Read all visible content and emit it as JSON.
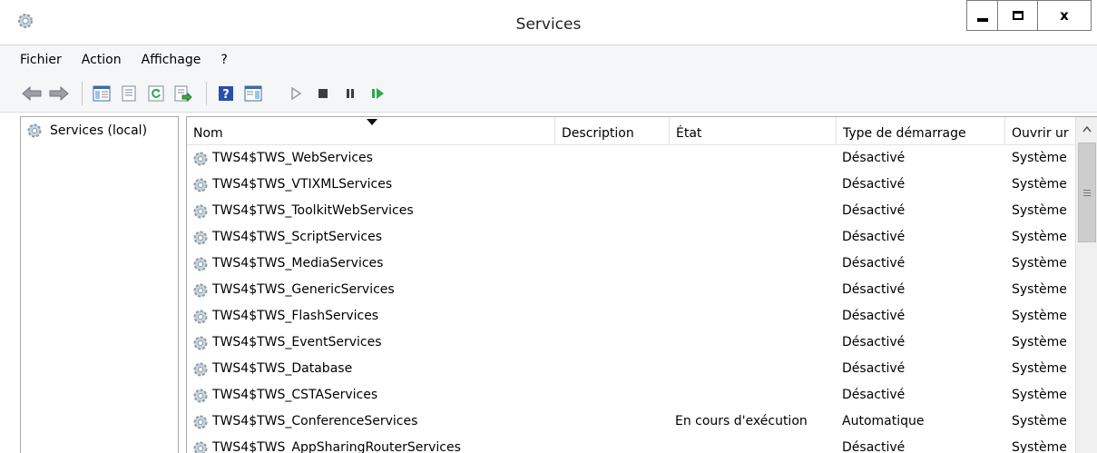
{
  "window": {
    "title": "Services",
    "minimize_label": "",
    "maximize_label": "",
    "close_label": "x"
  },
  "menubar": {
    "items": [
      "Fichier",
      "Action",
      "Affichage",
      "?"
    ]
  },
  "toolbar": {
    "buttons": [
      "back-arrow-icon",
      "forward-arrow-icon",
      "console-tree-icon",
      "properties-icon",
      "refresh-icon",
      "export-list-icon",
      "help-icon",
      "action-pane-icon",
      "start-service-icon",
      "stop-service-icon",
      "pause-service-icon",
      "restart-service-icon"
    ]
  },
  "tree": {
    "root_label": "Services (local)"
  },
  "table": {
    "columns": [
      "Nom",
      "Description",
      "État",
      "Type de démarrage",
      "Ouvrir ur"
    ],
    "sorted_column": "Nom",
    "rows": [
      {
        "name": "TWS4$TWS_WebServices",
        "description": "",
        "state": "",
        "startup": "Désactivé",
        "logon": "Système"
      },
      {
        "name": "TWS4$TWS_VTIXMLServices",
        "description": "",
        "state": "",
        "startup": "Désactivé",
        "logon": "Système"
      },
      {
        "name": "TWS4$TWS_ToolkitWebServices",
        "description": "",
        "state": "",
        "startup": "Désactivé",
        "logon": "Système"
      },
      {
        "name": "TWS4$TWS_ScriptServices",
        "description": "",
        "state": "",
        "startup": "Désactivé",
        "logon": "Système"
      },
      {
        "name": "TWS4$TWS_MediaServices",
        "description": "",
        "state": "",
        "startup": "Désactivé",
        "logon": "Système"
      },
      {
        "name": "TWS4$TWS_GenericServices",
        "description": "",
        "state": "",
        "startup": "Désactivé",
        "logon": "Système"
      },
      {
        "name": "TWS4$TWS_FlashServices",
        "description": "",
        "state": "",
        "startup": "Désactivé",
        "logon": "Système"
      },
      {
        "name": "TWS4$TWS_EventServices",
        "description": "",
        "state": "",
        "startup": "Désactivé",
        "logon": "Système"
      },
      {
        "name": "TWS4$TWS_Database",
        "description": "",
        "state": "",
        "startup": "Désactivé",
        "logon": "Système"
      },
      {
        "name": "TWS4$TWS_CSTAServices",
        "description": "",
        "state": "",
        "startup": "Désactivé",
        "logon": "Système"
      },
      {
        "name": "TWS4$TWS_ConferenceServices",
        "description": "",
        "state": "En cours d'exécution",
        "startup": "Automatique",
        "logon": "Système"
      },
      {
        "name": "TWS4$TWS_AppSharingRouterServices",
        "description": "",
        "state": "",
        "startup": "Désactivé",
        "logon": "Système"
      }
    ]
  },
  "colors": {
    "toolbar_bg": "#f5f6f7",
    "border": "#aaaaaa",
    "help_icon_blue": "#2b4fa8",
    "play_green": "#2ea84a"
  }
}
